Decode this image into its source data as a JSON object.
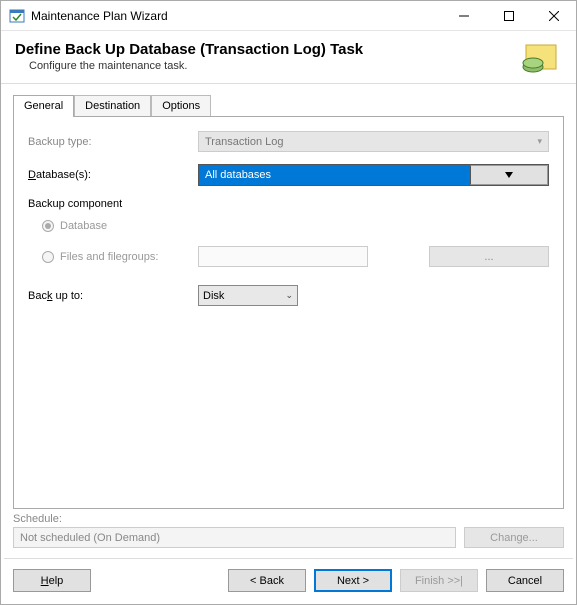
{
  "window": {
    "title": "Maintenance Plan Wizard"
  },
  "header": {
    "title": "Define Back Up Database (Transaction Log) Task",
    "subtitle": "Configure the maintenance task."
  },
  "tabs": {
    "general": "General",
    "destination": "Destination",
    "options": "Options"
  },
  "form": {
    "backup_type_label": "Backup type:",
    "backup_type_value": "Transaction Log",
    "databases_label": "Database(s):",
    "databases_value": "All databases",
    "backup_component_label": "Backup component",
    "radio_database": "Database",
    "radio_filegroups": "Files and filegroups:",
    "filegroups_btn": "...",
    "backup_to_label": "Back up to:",
    "backup_to_value": "Disk"
  },
  "schedule": {
    "label": "Schedule:",
    "value": "Not scheduled (On Demand)",
    "change_btn": "Change..."
  },
  "footer": {
    "help": "Help",
    "back": "< Back",
    "next": "Next >",
    "finish": "Finish >>|",
    "cancel": "Cancel"
  }
}
